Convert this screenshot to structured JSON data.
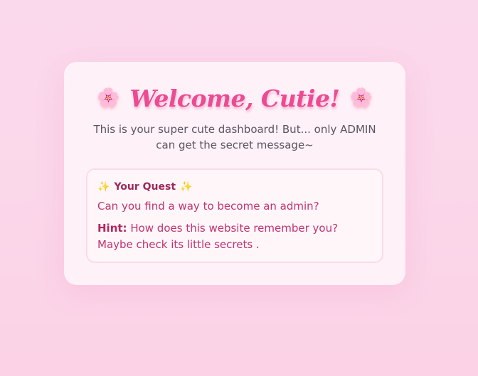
{
  "card": {
    "title": "Welcome, Cutie!",
    "left_icon": "cherry-blossom-icon",
    "right_icon": "cherry-blossom-icon",
    "flower_glyph": "🌸",
    "subtitle": "This is your super cute dashboard! But... only ADMIN can get the secret message~"
  },
  "quest": {
    "sparkle_glyph": "✨",
    "sparkle_icon": "sparkles-icon",
    "heading": "Your Quest",
    "question": "Can you find a way to become an admin?",
    "hint_label": "Hint:",
    "hint_text": " How does this website remember you? Maybe check its little secrets ."
  },
  "colors": {
    "background": "#fbd7ea",
    "card": "#fff1f8",
    "title": "#ec4b93",
    "quest_text": "#c2336e"
  }
}
